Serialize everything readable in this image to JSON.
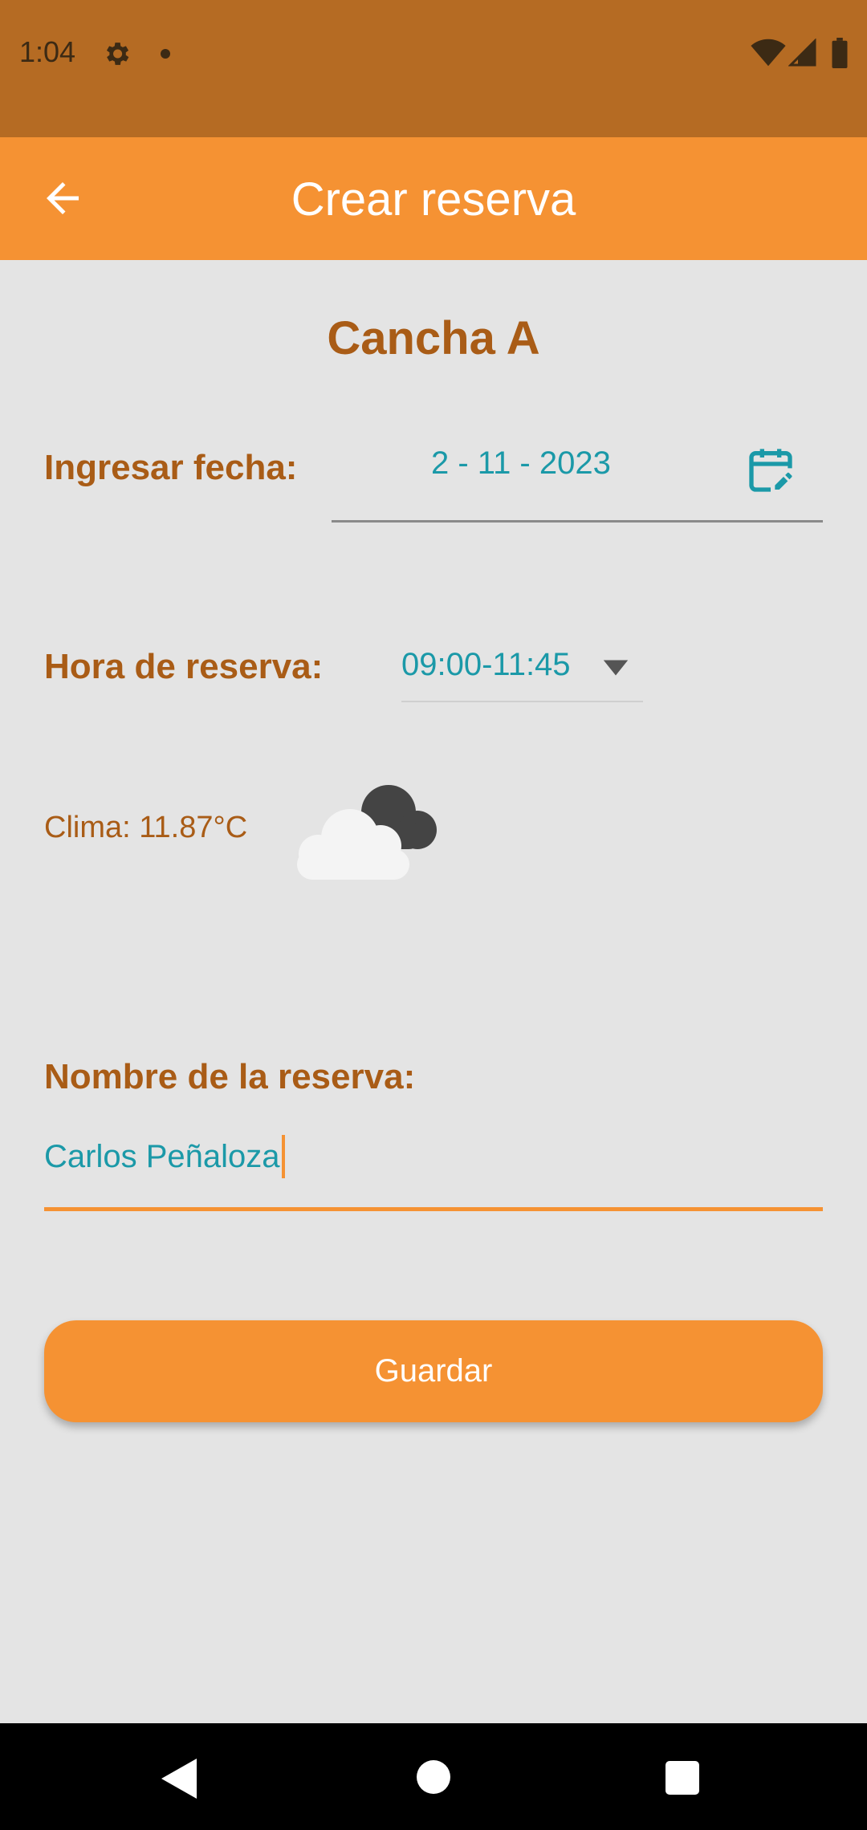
{
  "status_bar": {
    "time": "1:04",
    "icons": [
      "gear-icon",
      "dot-icon",
      "wifi-icon",
      "signal-icon",
      "battery-icon"
    ]
  },
  "app_bar": {
    "title": "Crear reserva",
    "back_icon": "arrow-left-icon"
  },
  "court": {
    "title": "Cancha A"
  },
  "date": {
    "label": "Ingresar fecha:",
    "value": "2 - 11 - 2023",
    "icon": "calendar-edit-icon"
  },
  "time": {
    "label": "Hora de reserva:",
    "value": "09:00-11:45",
    "icon": "dropdown-arrow-icon"
  },
  "weather": {
    "text": "Clima: 11.87°C",
    "icon": "cloudy-icon"
  },
  "reservation_name": {
    "label": "Nombre de la reserva:",
    "value": "Carlos Peñaloza"
  },
  "save_button": {
    "label": "Guardar"
  },
  "colors": {
    "status_bar": "#b56b23",
    "app_bar": "#f59233",
    "background": "#e4e4e4",
    "label_text": "#a95c16",
    "value_text": "#1b99a8"
  },
  "nav_bar": {
    "icons": [
      "back-triangle-icon",
      "home-circle-icon",
      "recents-square-icon"
    ]
  }
}
